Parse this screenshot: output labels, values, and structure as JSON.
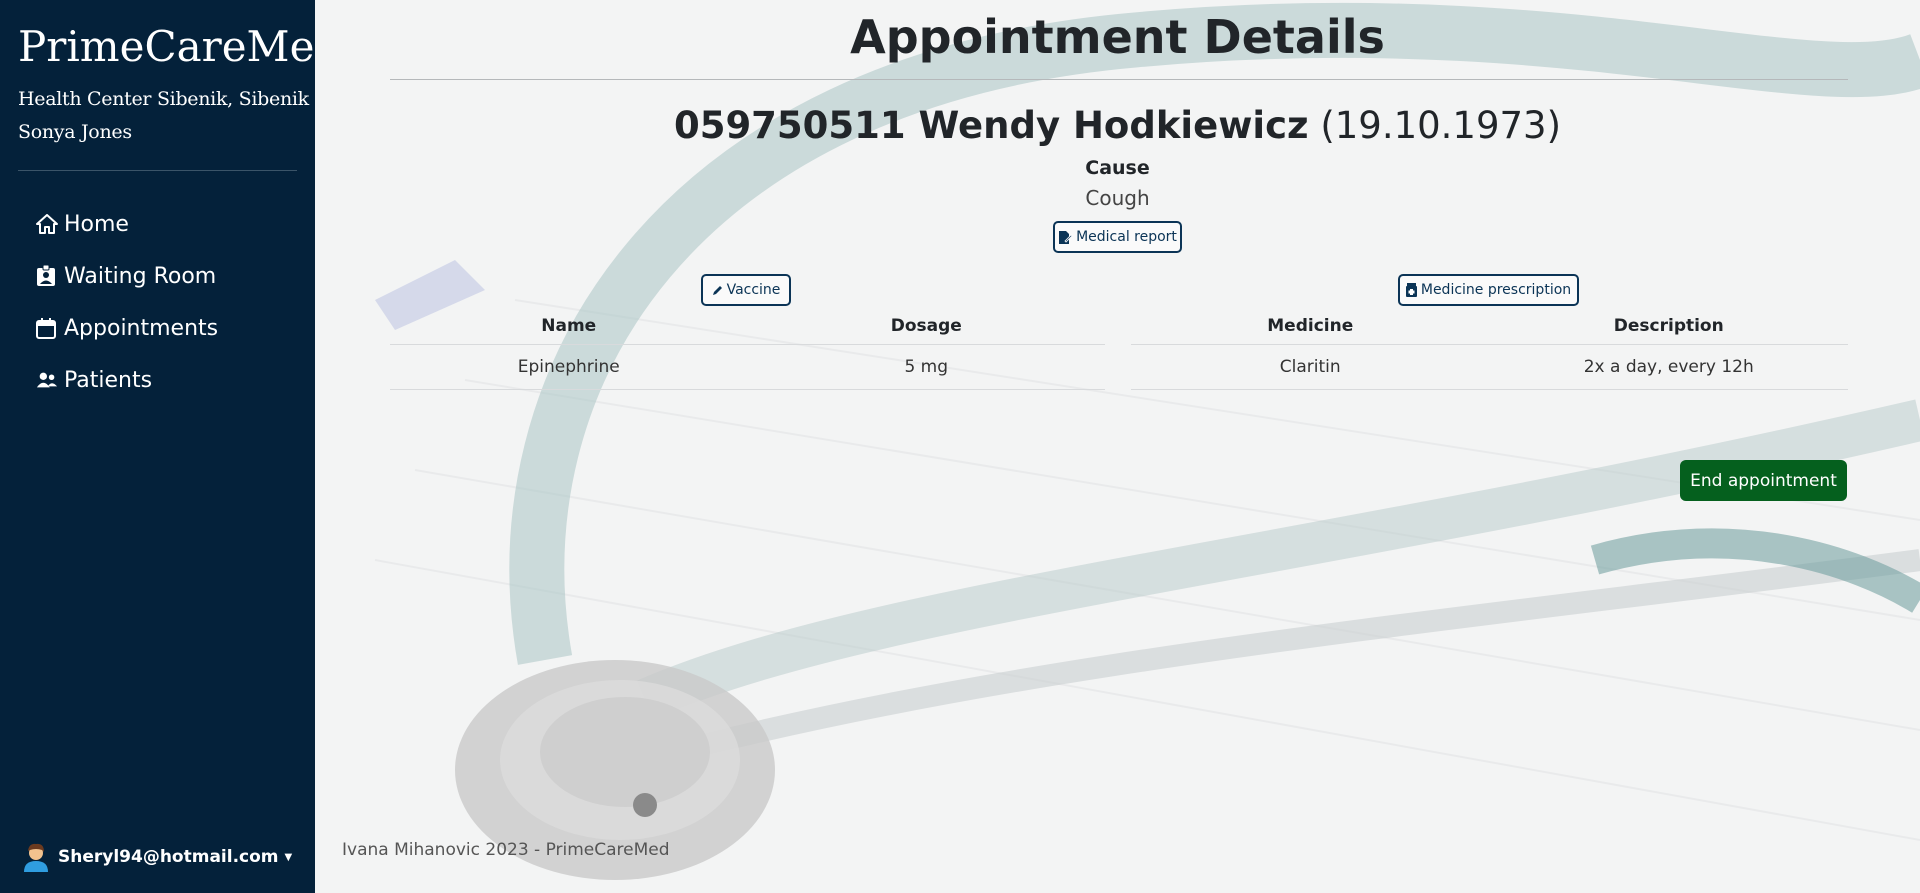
{
  "sidebar": {
    "brand": "PrimeCareMed",
    "center": "Health Center Sibenik, Sibenik",
    "doctor": "Sonya Jones",
    "nav": [
      {
        "label": "Home",
        "icon": "home-icon"
      },
      {
        "label": "Waiting Room",
        "icon": "badge-icon"
      },
      {
        "label": "Appointments",
        "icon": "calendar-icon"
      },
      {
        "label": "Patients",
        "icon": "users-icon"
      }
    ],
    "user_email": "Sheryl94@hotmail.com"
  },
  "main": {
    "title": "Appointment Details",
    "patient": {
      "id_name": "059750511 Wendy Hodkiewicz",
      "dob": "(19.10.1973)"
    },
    "cause_label": "Cause",
    "cause_value": "Cough",
    "medical_report_label": "Medical report",
    "vaccine_label": "Vaccine",
    "prescription_label": "Medicine prescription",
    "vaccines": {
      "headers": [
        "Name",
        "Dosage"
      ],
      "rows": [
        [
          "Epinephrine",
          "5 mg"
        ]
      ]
    },
    "medicines": {
      "headers": [
        "Medicine",
        "Description"
      ],
      "rows": [
        [
          "Claritin",
          "2x a day, every 12h"
        ]
      ]
    },
    "end_label": "End appointment",
    "footer": "Ivana Mihanovic 2023 - PrimeCareMed"
  },
  "colors": {
    "sidebar_bg": "#04213a",
    "accent_outline": "#0b3456",
    "end_button": "#05601e"
  }
}
